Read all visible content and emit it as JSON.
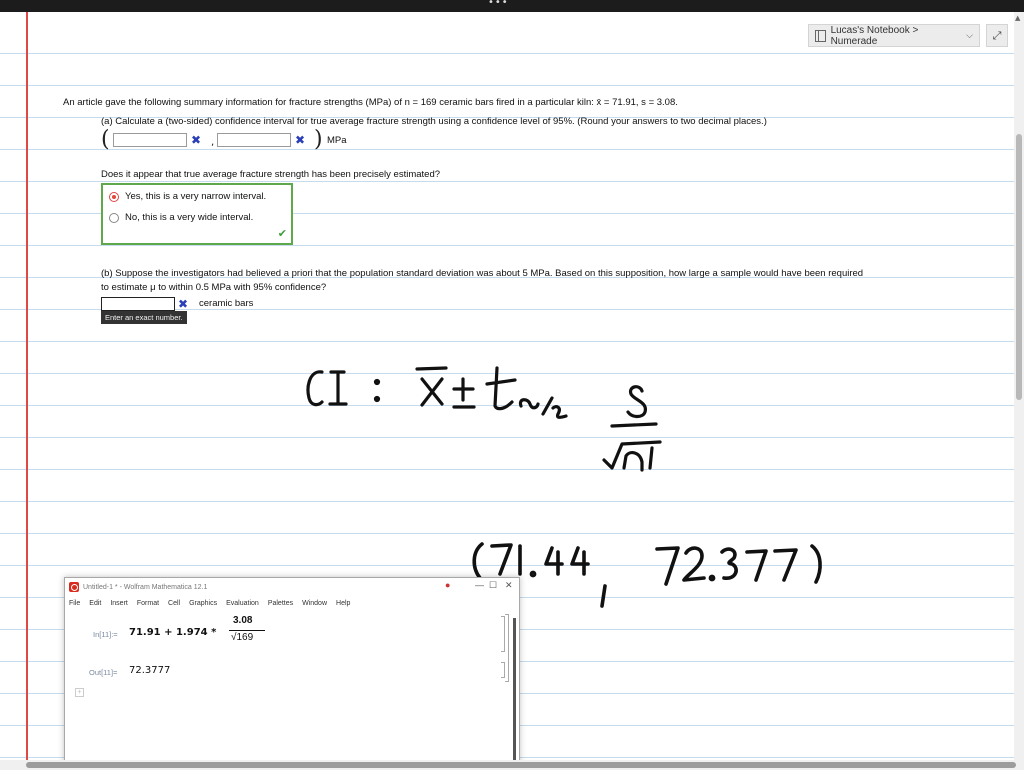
{
  "header": {
    "notebook_label": "Lucas's Notebook > Numerade",
    "chevron": "chevron-down-icon",
    "expand_icon": "expand-icon"
  },
  "question": {
    "intro": "An article gave the following summary information for fracture strengths (MPa) of n = 169 ceramic bars fired in a particular kiln: x̄ = 71.91, s = 3.08.",
    "part_a": "(a) Calculate a (two-sided) confidence interval for true average fracture strength using a confidence level of 95%. (Round your answers to two decimal places.)",
    "ci_lower_value": "",
    "ci_upper_value": "",
    "ci_unit": "MPa",
    "precision_question": "Does it appear that true average fracture strength has been precisely estimated?",
    "options": [
      {
        "label": "Yes, this is a very narrow interval.",
        "selected": true
      },
      {
        "label": "No, this is a very wide interval.",
        "selected": false
      }
    ],
    "part_b_line1": "(b) Suppose the investigators had believed a priori that the population standard deviation was about 5 MPa. Based on this supposition, how large a sample would have been required",
    "part_b_line2": "to estimate μ to within 0.5 MPa with 95% confidence?",
    "sample_value": "",
    "sample_unit": "ceramic bars",
    "tooltip": "Enter an exact number."
  },
  "handwriting": {
    "formula": "CI : x̄ ± tα/2 s/√n",
    "interval": "(71.44, 72.377)"
  },
  "mathematica": {
    "title": "Untitled-1 * - Wolfram Mathematica 12.1",
    "menu": [
      "File",
      "Edit",
      "Insert",
      "Format",
      "Cell",
      "Graphics",
      "Evaluation",
      "Palettes",
      "Window",
      "Help"
    ],
    "in_label": "In[11]:=",
    "in_expr": "71.91 + 1.974 *",
    "frac_num": "3.08",
    "frac_den": "√169",
    "out_label": "Out[11]=",
    "out_value": "72.3777"
  },
  "colors": {
    "margin": "#e04848",
    "rule": "#c6dbee",
    "wrong": "#2b3fb8",
    "correct": "#5fa94c"
  }
}
